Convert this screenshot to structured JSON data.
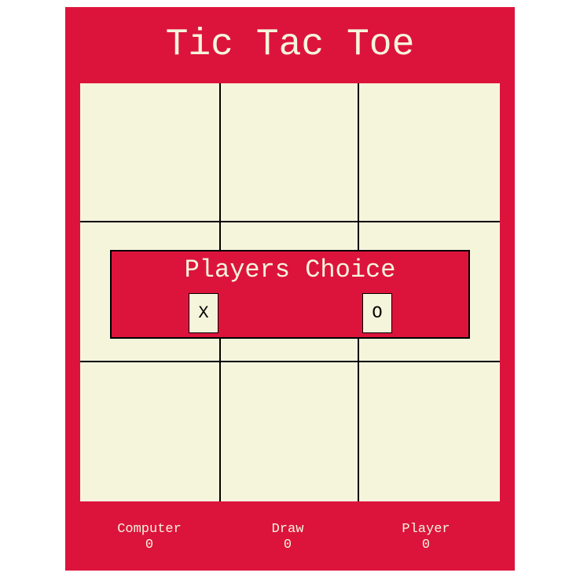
{
  "app": {
    "title": "Tic Tac Toe"
  },
  "colors": {
    "background": "#dc143c",
    "board": "#f5f5dc",
    "text": "#f5f5dc",
    "grid": "#000000"
  },
  "board": {
    "cells": [
      "",
      "",
      "",
      "",
      "",
      "",
      "",
      "",
      ""
    ]
  },
  "dialog": {
    "title": "Players Choice",
    "option_x": "X",
    "option_o": "O"
  },
  "scores": {
    "computer": {
      "label": "Computer",
      "value": "0"
    },
    "draw": {
      "label": "Draw",
      "value": "0"
    },
    "player": {
      "label": "Player",
      "value": "0"
    }
  }
}
